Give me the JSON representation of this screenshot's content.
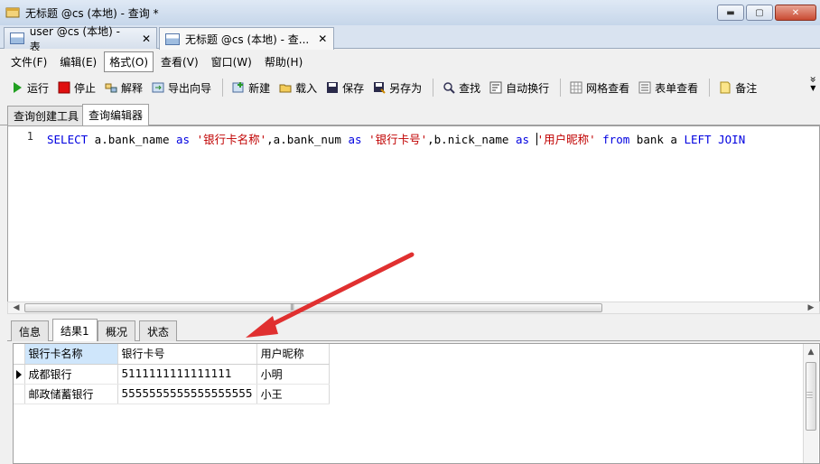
{
  "window": {
    "title": "无标题 @cs (本地) - 查询 *",
    "controls": {
      "minimize": "▬",
      "maximize": "▢",
      "close": "✕"
    }
  },
  "doc_tabs": [
    {
      "label": "user @cs (本地) - 表",
      "close": "✕"
    },
    {
      "label": "无标题 @cs (本地) - 查...",
      "close": "✕"
    }
  ],
  "menu": [
    "文件(F)",
    "编辑(E)",
    "格式(O)",
    "查看(V)",
    "窗口(W)",
    "帮助(H)"
  ],
  "toolbar": {
    "run": "运行",
    "stop": "停止",
    "explain": "解释",
    "export_wizard": "导出向导",
    "new": "新建",
    "load": "载入",
    "save": "保存",
    "save_as": "另存为",
    "find": "查找",
    "word_wrap": "自动换行",
    "grid_view": "网格查看",
    "form_view": "表单查看",
    "memo": "备注",
    "more": "»"
  },
  "editor_tabs": [
    "查询创建工具",
    "查询编辑器"
  ],
  "editor": {
    "line_number": "1",
    "tokens": [
      {
        "t": "SELECT",
        "c": "kw"
      },
      {
        "t": " a.bank_name ",
        "c": "plain"
      },
      {
        "t": "as",
        "c": "kw"
      },
      {
        "t": " ",
        "c": "plain"
      },
      {
        "t": "'银行卡名称'",
        "c": "str"
      },
      {
        "t": ",a.bank_num ",
        "c": "plain"
      },
      {
        "t": "as",
        "c": "kw"
      },
      {
        "t": " ",
        "c": "plain"
      },
      {
        "t": "'银行卡号'",
        "c": "str"
      },
      {
        "t": ",b.nick_name ",
        "c": "plain"
      },
      {
        "t": "as",
        "c": "kw"
      },
      {
        "t": " ",
        "c": "plain"
      },
      {
        "t": "'用户昵称'",
        "c": "str"
      },
      {
        "t": " ",
        "c": "plain"
      },
      {
        "t": "from",
        "c": "kw"
      },
      {
        "t": " bank a ",
        "c": "plain"
      },
      {
        "t": "LEFT",
        "c": "kw"
      },
      {
        "t": " ",
        "c": "plain"
      },
      {
        "t": "JOIN",
        "c": "kw"
      }
    ]
  },
  "result_tabs": [
    "信息",
    "结果1",
    "概况",
    "状态"
  ],
  "grid": {
    "columns": [
      "银行卡名称",
      "银行卡号",
      "用户昵称"
    ],
    "rows": [
      [
        "成都银行",
        "5111111111111111",
        "小明"
      ],
      [
        "邮政储蓄银行",
        "5555555555555555555",
        "小王"
      ]
    ]
  },
  "colors": {
    "keyword": "#0000e0",
    "string": "#c00000",
    "annotation_arrow": "#e03030",
    "selected_header": "#cfe6fb"
  }
}
